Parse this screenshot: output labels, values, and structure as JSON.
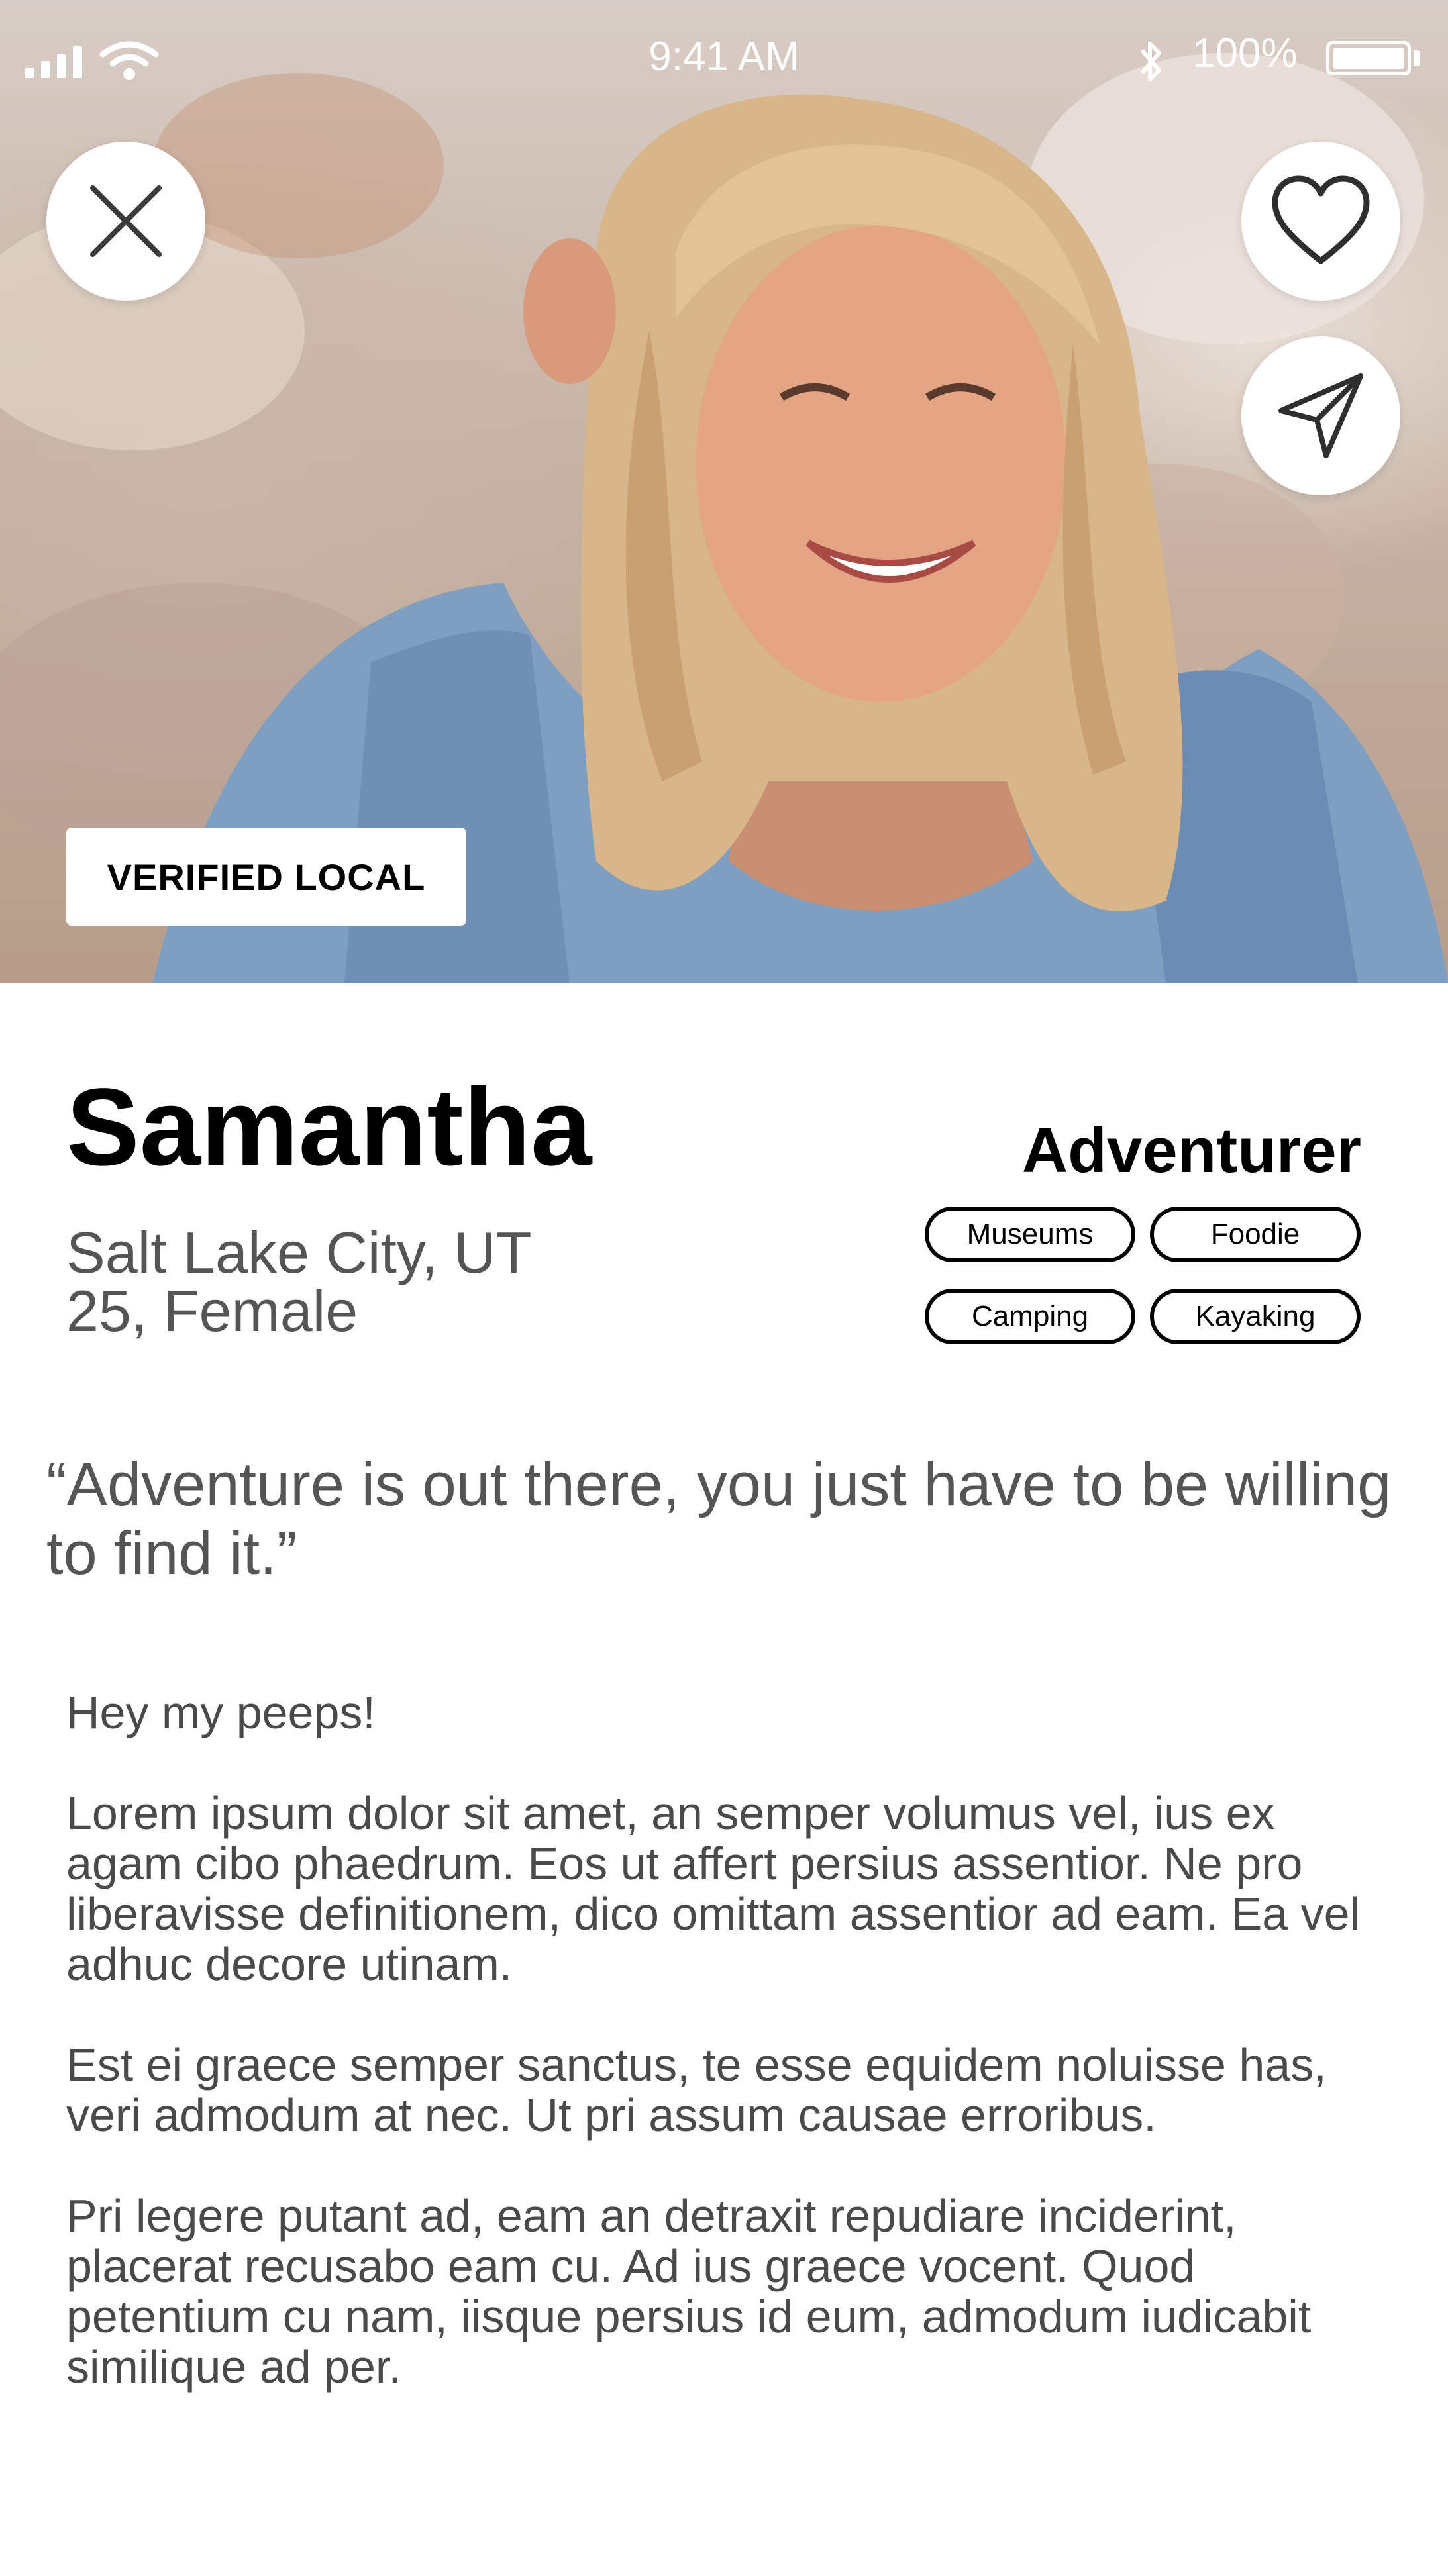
{
  "status_bar": {
    "time": "9:41 AM",
    "battery": "100%",
    "icons": [
      "signal-icon",
      "wifi-icon",
      "bluetooth-icon",
      "battery-icon"
    ]
  },
  "hero": {
    "photo_alt": "profile-photo",
    "verified_badge": "VERIFIED LOCAL",
    "buttons": {
      "dismiss": "close-icon",
      "like": "heart-icon",
      "message": "send-icon"
    }
  },
  "profile": {
    "name": "Samantha",
    "location": "Salt Lake City, UT",
    "age_gender": "25, Female",
    "persona": "Adventurer",
    "tags": [
      "Museums",
      "Foodie",
      "Camping",
      "Kayaking"
    ]
  },
  "quote": "“Adventure is out there, you just have to be willing to find it.”",
  "bio": {
    "greeting": "Hey my peeps!",
    "paragraphs": [
      "Lorem ipsum dolor sit amet, an semper volumus vel, ius ex agam cibo phaedrum. Eos ut affert persius assentior. Ne pro liberavisse definitionem, dico omittam assentior ad eam. Ea vel adhuc decore utinam.",
      "Est ei graece semper sanctus, te esse equidem noluisse has, veri admodum at nec. Ut pri assum causae erroribus.",
      "Pri legere putant ad, eam an detraxit repudiare inciderint, placerat recusabo eam cu. Ad ius graece vocent. Quod petentium cu nam, iisque persius id eum, admodum iudicabit similique ad per."
    ]
  },
  "colors": {
    "text_primary": "#000000",
    "text_secondary": "#555555",
    "badge_bg": "#ffffff"
  }
}
